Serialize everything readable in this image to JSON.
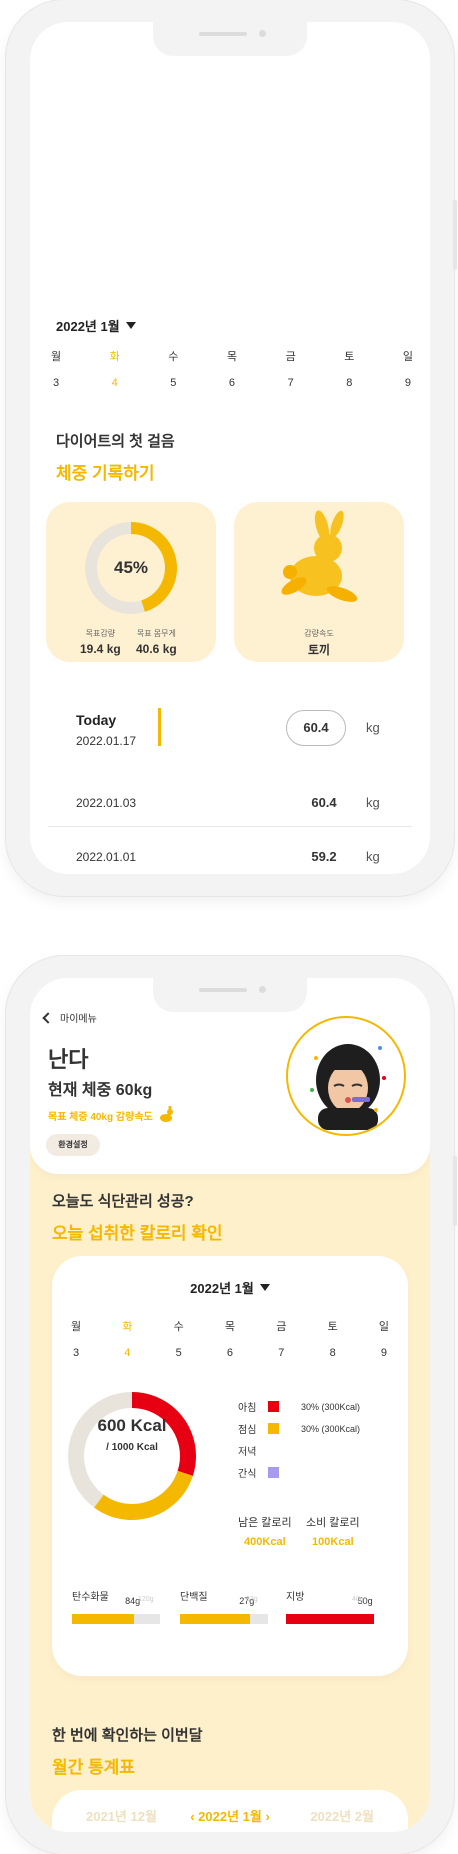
{
  "weight_screen": {
    "month": "2022년 1월",
    "week": [
      {
        "dow": "월",
        "date": "3"
      },
      {
        "dow": "화",
        "date": "4",
        "active": true
      },
      {
        "dow": "수",
        "date": "5"
      },
      {
        "dow": "목",
        "date": "6"
      },
      {
        "dow": "금",
        "date": "7"
      },
      {
        "dow": "토",
        "date": "8"
      },
      {
        "dow": "일",
        "date": "9"
      }
    ],
    "title_line1": "다이어트의 첫 걸음",
    "title_line2": "체중 기록하기",
    "progress": {
      "percent_label": "45%",
      "fraction": 0.45
    },
    "goal_loss_label": "목표감량",
    "goal_loss_value": "19.4 kg",
    "goal_weight_label": "목표 몸무게",
    "goal_weight_value": "40.6 kg",
    "speed_label": "감량속도",
    "speed_value": "토끼",
    "records": [
      {
        "title": "Today",
        "date": "2022.01.17",
        "weight": "60.4",
        "unit": "kg"
      },
      {
        "date": "2022.01.03",
        "weight": "60.4",
        "unit": "kg"
      },
      {
        "date": "2022.01.01",
        "weight": "59.2",
        "unit": "kg"
      }
    ]
  },
  "mypage": {
    "back_label": "마이메뉴",
    "name": "난다",
    "current_weight": "현재 체중 60kg",
    "goal_text": "목표 체중 40kg 감량속도",
    "settings_button": "환경설정",
    "title_line1": "오늘도 식단관리 성공?",
    "title_line2": "오늘 섭취한 칼로리 확인",
    "month": "2022년 1월",
    "week": [
      {
        "dow": "월",
        "date": "3"
      },
      {
        "dow": "화",
        "date": "4",
        "active": true
      },
      {
        "dow": "수",
        "date": "5"
      },
      {
        "dow": "목",
        "date": "6"
      },
      {
        "dow": "금",
        "date": "7"
      },
      {
        "dow": "토",
        "date": "8"
      },
      {
        "dow": "일",
        "date": "9"
      }
    ],
    "calorie_total": "600 Kcal",
    "calorie_goal": "/ 1000 Kcal",
    "calorie_chart": {
      "breakfast_fraction": 0.3,
      "lunch_fraction": 0.3
    },
    "meals": [
      {
        "label": "아침",
        "color": "#e60012",
        "percent": "30% (300Kcal)"
      },
      {
        "label": "점심",
        "color": "#f5b800",
        "percent": "30% (300Kcal)"
      },
      {
        "label": "저녁",
        "color": "",
        "percent": ""
      },
      {
        "label": "간식",
        "color": "#a79bf0",
        "percent": ""
      }
    ],
    "remaining_label": "남은 칼로리",
    "remaining_value": "400Kcal",
    "burned_label": "소비 칼로리",
    "burned_value": "100Kcal",
    "nutrients": [
      {
        "label": "탄수화물",
        "amount": "84g",
        "max": "120g",
        "fraction": 0.7,
        "color": "#f5b800"
      },
      {
        "label": "단백질",
        "amount": "27g",
        "max": "33g",
        "fraction": 0.8,
        "color": "#f5b800"
      },
      {
        "label": "지방",
        "amount": "50g",
        "max": "40g",
        "fraction": 1.0,
        "color": "#e60012"
      }
    ],
    "monthly_title1": "한 번에 확인하는 이번달",
    "monthly_title2": "월간 통계표",
    "month_prev": "2021년 12월",
    "month_current": "2022년 1월",
    "month_next": "2022년 2월"
  },
  "colors": {
    "accent": "#f5b800",
    "accent_bg": "#fff0cc",
    "card_bg": "#fdf1d2",
    "red": "#e60012"
  }
}
